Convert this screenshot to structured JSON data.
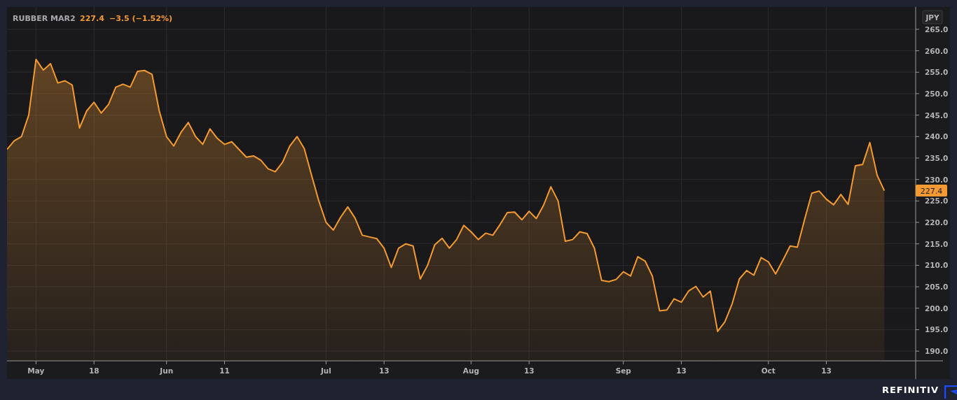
{
  "chart": {
    "price": "227.4",
    "change": "−3.5 (−1.52%)",
    "currency": "JPY",
    "last_value_tag": "227.4",
    "chart_data": {
      "type": "area",
      "categories": [
        null,
        null,
        null,
        null,
        "May",
        null,
        null,
        null,
        null,
        null,
        null,
        null,
        "18",
        null,
        null,
        null,
        null,
        null,
        null,
        null,
        null,
        null,
        "Jun",
        null,
        null,
        null,
        null,
        null,
        null,
        null,
        "11",
        null,
        null,
        null,
        null,
        null,
        null,
        null,
        null,
        null,
        null,
        null,
        null,
        null,
        "Jul",
        null,
        null,
        null,
        null,
        null,
        null,
        null,
        "13",
        null,
        null,
        null,
        null,
        null,
        null,
        null,
        null,
        null,
        null,
        null,
        "Aug",
        null,
        null,
        null,
        null,
        null,
        null,
        null,
        "13",
        null,
        null,
        null,
        null,
        null,
        null,
        null,
        null,
        null,
        null,
        null,
        null,
        "Sep",
        null,
        null,
        null,
        null,
        null,
        null,
        null,
        "13",
        null,
        null,
        null,
        null,
        null,
        null,
        null,
        null,
        null,
        null,
        null,
        "Oct",
        null,
        null,
        null,
        null,
        null,
        null,
        null,
        "13",
        null,
        null,
        null,
        null,
        null,
        null,
        null,
        null
      ],
      "series": [
        {
          "name": "RUBBER MAR2",
          "color": "#f59a32",
          "values": [
            237,
            239,
            240,
            245,
            258,
            255.5,
            257,
            252.5,
            253,
            252,
            242,
            246,
            248,
            245.5,
            247.5,
            251.5,
            252.2,
            251.5,
            255.2,
            255.4,
            254.5,
            246,
            240,
            237.8,
            241,
            243.3,
            240,
            238.2,
            241.8,
            239.6,
            238.2,
            238.8,
            237,
            235.2,
            235.5,
            234.5,
            232.5,
            231.8,
            234,
            237.8,
            240,
            237.2,
            231,
            225,
            220,
            218.2,
            221.2,
            223.6,
            221,
            217,
            216.6,
            216.2,
            214,
            209.5,
            214,
            215,
            214.5,
            206.8,
            210,
            214.8,
            216.3,
            214,
            216,
            219.3,
            217.8,
            216,
            217.5,
            217,
            219.5,
            222.3,
            222.4,
            220.6,
            222.6,
            220.9,
            224,
            228.3,
            225,
            215.6,
            216,
            217.8,
            217.4,
            214,
            206.5,
            206.2,
            206.7,
            208.5,
            207.5,
            212,
            211,
            207.5,
            199.4,
            199.6,
            202.2,
            201.4,
            204,
            205.1,
            202.6,
            204,
            194.6,
            196.8,
            201,
            206.8,
            208.8,
            207.7,
            211.8,
            210.8,
            208,
            211.2,
            214.5,
            214.2,
            220.7,
            226.8,
            227.3,
            225.4,
            224.1,
            226.5,
            224.2,
            233.2,
            233.5,
            238.6,
            231,
            227.4
          ]
        }
      ],
      "ylim": [
        187.9,
        270.2
      ],
      "grid": true,
      "yticks": [
        {
          "value": 190,
          "label": "190.0"
        },
        {
          "value": 195,
          "label": "195.0"
        },
        {
          "value": 200,
          "label": "200.0"
        },
        {
          "value": 205,
          "label": "205.0"
        },
        {
          "value": 210,
          "label": "210.0"
        },
        {
          "value": 215,
          "label": "215.0"
        },
        {
          "value": 220,
          "label": "220.0"
        },
        {
          "value": 225,
          "label": "225.0"
        },
        {
          "value": 230,
          "label": "230.0"
        },
        {
          "value": 235,
          "label": "235.0"
        },
        {
          "value": 240,
          "label": "240.0"
        },
        {
          "value": 245,
          "label": "245.0"
        },
        {
          "value": 250,
          "label": "250.0"
        },
        {
          "value": 255,
          "label": "255.0"
        },
        {
          "value": 260,
          "label": "260.0"
        },
        {
          "value": 265,
          "label": "265.0"
        }
      ]
    }
  },
  "footer": {
    "brand": "REFINITIV"
  }
}
